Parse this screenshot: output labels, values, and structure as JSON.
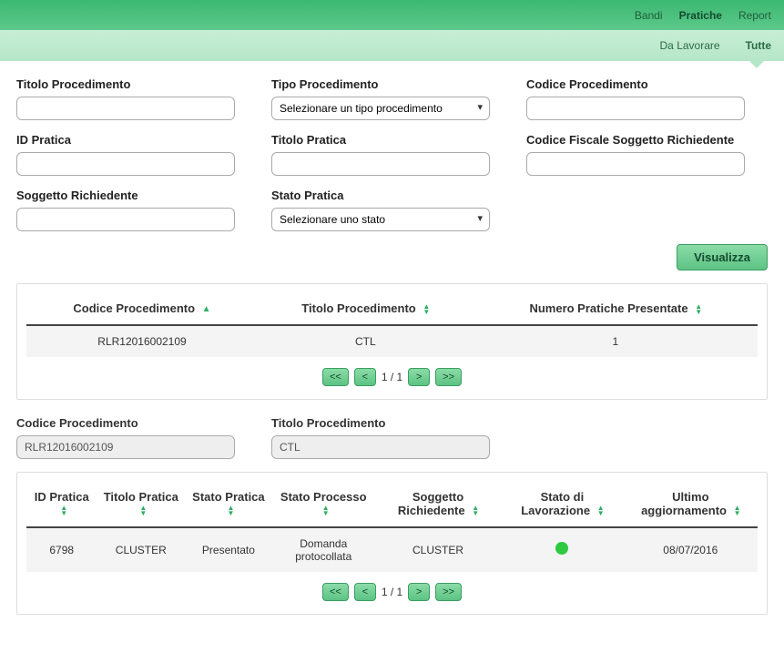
{
  "topnav": {
    "items": [
      {
        "label": "Bandi"
      },
      {
        "label": "Pratiche"
      },
      {
        "label": "Report"
      }
    ],
    "active_index": 1
  },
  "subnav": {
    "items": [
      {
        "label": "Da Lavorare"
      },
      {
        "label": "Tutte"
      }
    ],
    "active_index": 1
  },
  "filters": {
    "titolo_procedimento_label": "Titolo Procedimento",
    "tipo_procedimento_label": "Tipo Procedimento",
    "tipo_procedimento_placeholder": "Selezionare un tipo procedimento",
    "codice_procedimento_label": "Codice Procedimento",
    "id_pratica_label": "ID Pratica",
    "titolo_pratica_label": "Titolo Pratica",
    "cf_label": "Codice Fiscale Soggetto Richiedente",
    "soggetto_richiedente_label": "Soggetto Richiedente",
    "stato_pratica_label": "Stato Pratica",
    "stato_pratica_placeholder": "Selezionare uno stato",
    "visualizza_btn": "Visualizza"
  },
  "proc_table": {
    "headers": {
      "codice": "Codice Procedimento",
      "titolo": "Titolo Procedimento",
      "numero": "Numero Pratiche Presentate"
    },
    "rows": [
      {
        "codice": "RLR12016002109",
        "titolo": "CTL",
        "numero": "1"
      }
    ],
    "pager": {
      "first": "<<",
      "prev": "<",
      "label": "1 / 1",
      "next": ">",
      "last": ">>"
    }
  },
  "detail": {
    "codice_label": "Codice Procedimento",
    "codice_value": "RLR12016002109",
    "titolo_label": "Titolo Procedimento",
    "titolo_value": "CTL"
  },
  "pratiche_table": {
    "headers": {
      "id": "ID Pratica",
      "titolo": "Titolo Pratica",
      "stato_pratica": "Stato Pratica",
      "stato_processo": "Stato Processo",
      "soggetto": "Soggetto Richiedente",
      "stato_lavorazione": "Stato di Lavorazione",
      "ultimo": "Ultimo aggiornamento"
    },
    "rows": [
      {
        "id": "6798",
        "titolo": "CLUSTER",
        "stato_pratica": "Presentato",
        "stato_processo": "Domanda protocollata",
        "soggetto": "CLUSTER",
        "stato_lavorazione_color": "#2ec940",
        "ultimo": "08/07/2016"
      }
    ],
    "pager": {
      "first": "<<",
      "prev": "<",
      "label": "1 / 1",
      "next": ">",
      "last": ">>"
    }
  }
}
